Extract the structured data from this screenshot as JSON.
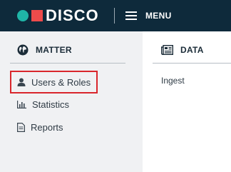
{
  "brand": {
    "name": "DISCO"
  },
  "header": {
    "menu_label": "MENU"
  },
  "matter": {
    "title": "MATTER",
    "items": [
      {
        "label": "Users & Roles",
        "icon": "user-icon",
        "highlighted": true
      },
      {
        "label": "Statistics",
        "icon": "bar-chart-icon"
      },
      {
        "label": "Reports",
        "icon": "document-icon"
      }
    ]
  },
  "data": {
    "title": "DATA",
    "items": [
      {
        "label": "Ingest"
      }
    ]
  },
  "colors": {
    "topbar": "#0e2a3b",
    "logo_dot": "#1fb5a7",
    "logo_square": "#ee4b4b",
    "highlight": "#d9262c"
  }
}
